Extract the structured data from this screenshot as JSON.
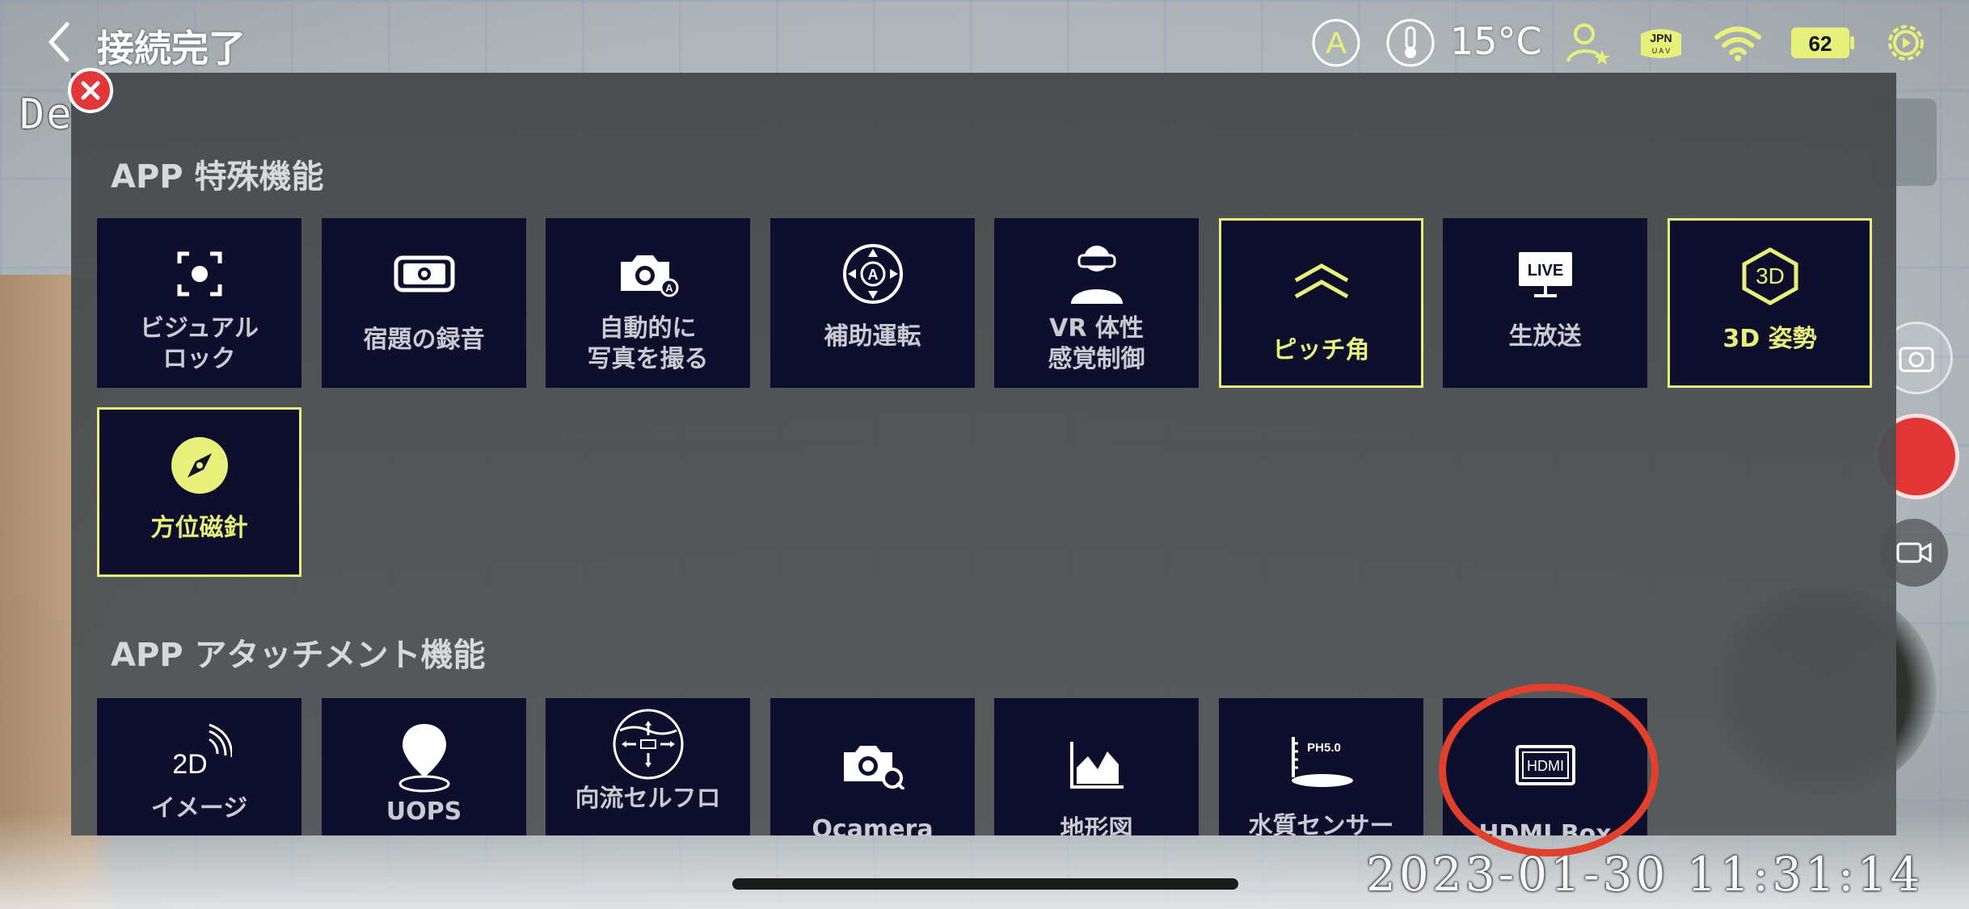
{
  "header": {
    "title": "接続完了",
    "temperature": "15°C",
    "mode_badge": "A",
    "region_badge": "JPN",
    "region_badge_sub": "U A V",
    "battery": "62"
  },
  "overlay": {
    "osd_text": "De",
    "timestamp": "2023-01-30 11:31:14"
  },
  "sections": [
    {
      "title": "APP 特殊機能",
      "tiles": [
        {
          "label": "ビジュアル\nロック",
          "icon": "visual-lock-icon",
          "active": false
        },
        {
          "label": "宿題の録音",
          "icon": "phone-record-icon",
          "active": false
        },
        {
          "label": "自動的に\n写真を撮る",
          "icon": "auto-photo-icon",
          "active": false
        },
        {
          "label": "補助運転",
          "icon": "assist-drive-icon",
          "active": false
        },
        {
          "label": "VR 体性\n感覚制御",
          "icon": "vr-headset-icon",
          "active": false
        },
        {
          "label": "ピッチ角",
          "icon": "pitch-chevron-icon",
          "active": true
        },
        {
          "label": "生放送",
          "icon": "live-icon",
          "active": false
        },
        {
          "label": "3D 姿勢",
          "icon": "3d-icon",
          "active": true
        },
        {
          "label": "方位磁針",
          "icon": "compass-icon",
          "active": true
        }
      ]
    },
    {
      "title": "APP アタッチメント機能",
      "tiles": [
        {
          "label": "イメージ",
          "icon": "2d-sonar-icon",
          "active": false
        },
        {
          "label": "UOPS",
          "icon": "location-pin-icon",
          "active": false
        },
        {
          "label": "向流セルフロ",
          "icon": "flow-control-icon",
          "active": false
        },
        {
          "label": "Qcamera",
          "icon": "qcamera-icon",
          "active": false
        },
        {
          "label": "地形図",
          "icon": "terrain-chart-icon",
          "active": false
        },
        {
          "label": "水質センサー",
          "icon": "ph-sensor-icon",
          "active": false
        },
        {
          "label": "HDMI Box",
          "icon": "hdmi-icon",
          "active": false
        }
      ]
    }
  ],
  "icon_text": {
    "live": "LIVE",
    "three_d": "3D",
    "two_d": "2D",
    "ph": "PH5.0",
    "hdmi": "HDMI"
  },
  "colors": {
    "tile_bg": "#0d0f2c",
    "active": "#e6f07a",
    "highlight_circle": "#e2402c",
    "close": "#e2363b"
  }
}
